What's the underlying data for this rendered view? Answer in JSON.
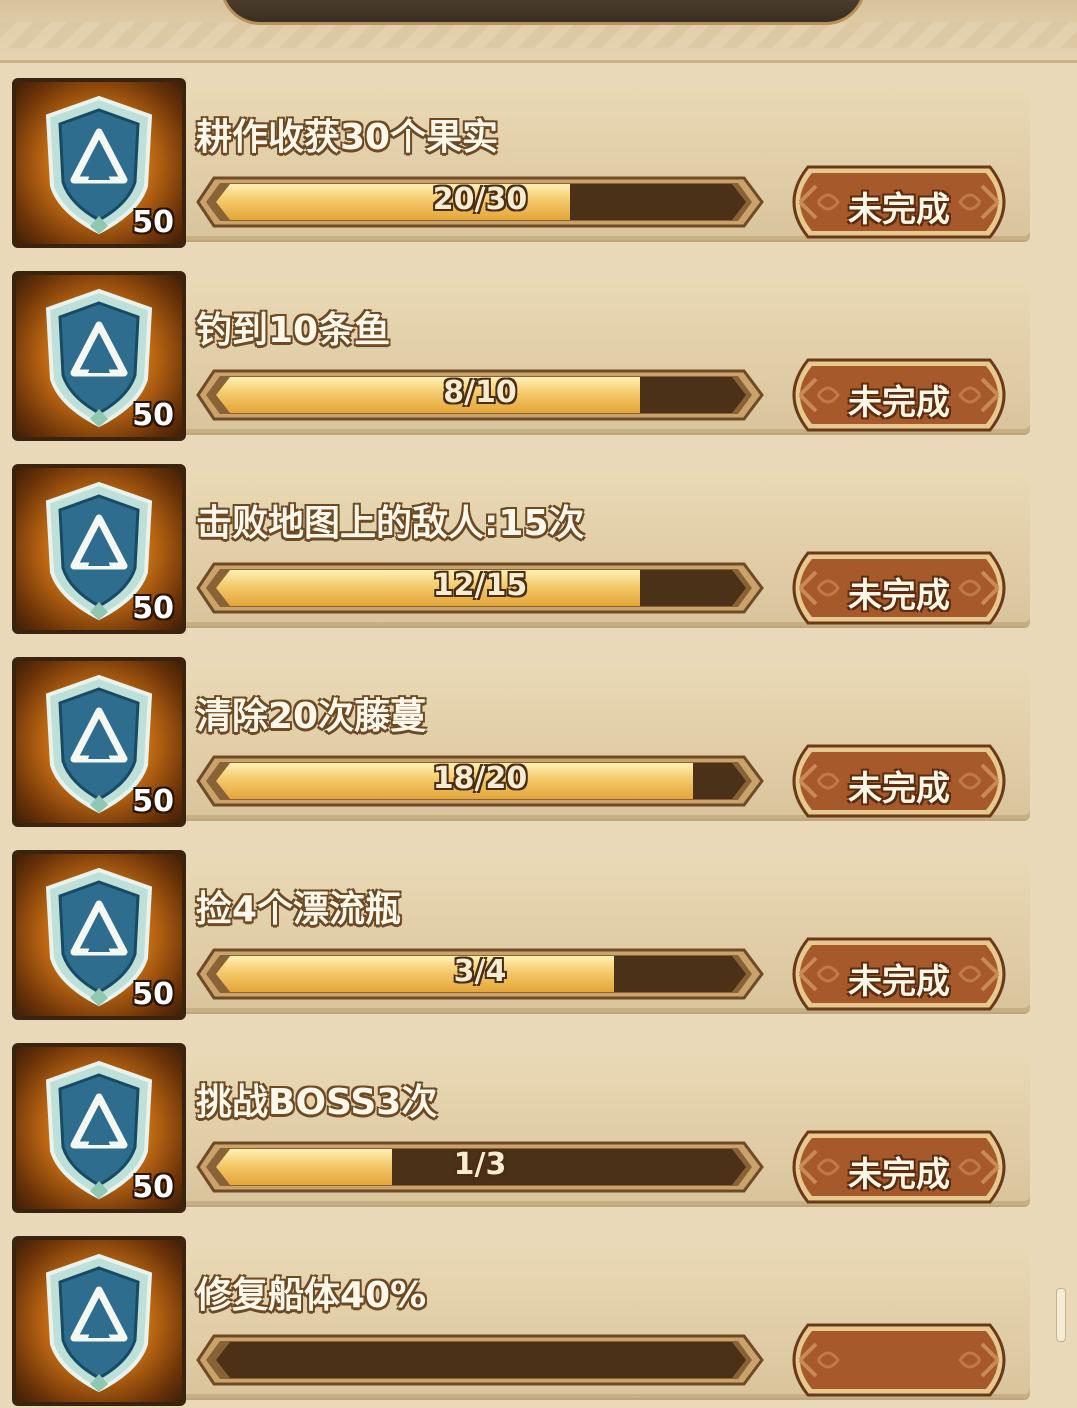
{
  "header": {
    "emblem_icon": "header-ornament-icon"
  },
  "button_color": "#a65a2c",
  "fill_color": "#f4c96b",
  "track_color": "#4b3118",
  "tasks": [
    {
      "title": "耕作收获30个果实",
      "progress_text": "20/30",
      "progress": 0.667,
      "reward": "50",
      "status": "未完成",
      "icon": "camp-shield-icon"
    },
    {
      "title": "钓到10条鱼",
      "progress_text": "8/10",
      "progress": 0.8,
      "reward": "50",
      "status": "未完成",
      "icon": "camp-shield-icon"
    },
    {
      "title": "击败地图上的敌人:15次",
      "progress_text": "12/15",
      "progress": 0.8,
      "reward": "50",
      "status": "未完成",
      "icon": "camp-shield-icon"
    },
    {
      "title": "清除20次藤蔓",
      "progress_text": "18/20",
      "progress": 0.9,
      "reward": "50",
      "status": "未完成",
      "icon": "camp-shield-icon"
    },
    {
      "title": "捡4个漂流瓶",
      "progress_text": "3/4",
      "progress": 0.75,
      "reward": "50",
      "status": "未完成",
      "icon": "camp-shield-icon"
    },
    {
      "title": "挑战BOSS3次",
      "progress_text": "1/3",
      "progress": 0.333,
      "reward": "50",
      "status": "未完成",
      "icon": "camp-shield-icon"
    },
    {
      "title": "修复船体40%",
      "progress_text": "",
      "progress": 0,
      "reward": "",
      "status": "",
      "icon": "camp-shield-icon"
    }
  ]
}
